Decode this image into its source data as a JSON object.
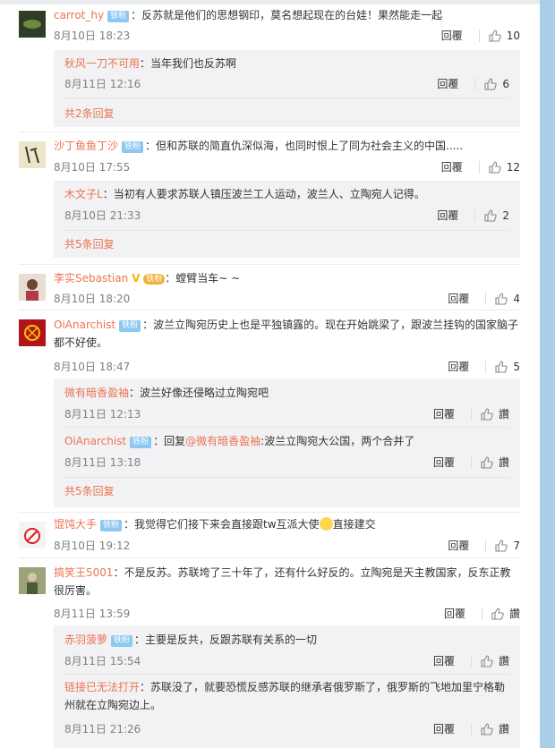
{
  "comments": [
    {
      "user": "carrot_hy",
      "badge": "铁粉",
      "text": "：反苏就是他们的思想钢印，莫名想起现在的台娃！果然能走一起",
      "time": "8月10日 18:23",
      "reply": "回覆",
      "likes": "10",
      "subs": [
        {
          "user": "秋风一刀不可用",
          "text": "：当年我们也反苏啊",
          "time": "8月11日 12:16",
          "reply": "回覆",
          "likes": "6"
        }
      ],
      "more": "共2条回复"
    },
    {
      "user": "沙丁鱼鱼丁沙",
      "badge": "铁粉",
      "text": "：但和苏联的简直仇深似海，也同时恨上了同为社会主义的中国.....",
      "time": "8月10日 17:55",
      "reply": "回覆",
      "likes": "12",
      "subs": [
        {
          "user": "木文子L",
          "text": "：当初有人要求苏联人镇压波兰工人运动，波兰人、立陶宛人记得。",
          "time": "8月10日 21:33",
          "reply": "回覆",
          "likes": "2"
        }
      ],
      "more": "共5条回复"
    },
    {
      "user": "李实Sebastian",
      "medal": "铁粉",
      "text": "：螳臂当车~ ~",
      "time": "8月10日 18:20",
      "reply": "回覆",
      "likes": "4"
    },
    {
      "user": "OiAnarchist",
      "badge": "铁粉",
      "text": "：波兰立陶宛历史上也是平独镇露的。现在开始跳梁了，跟波兰挂钩的国家脑子都不好使。",
      "time": "8月10日 18:47",
      "reply": "回覆",
      "likes": "5",
      "subs": [
        {
          "user": "微有暗香盈袖",
          "text": "：波兰好像还侵略过立陶宛吧",
          "time": "8月11日 12:13",
          "reply": "回覆",
          "likes": "讚"
        },
        {
          "user": "OiAnarchist",
          "badge": "铁粉",
          "text_pre": "：回复",
          "mention": "@微有暗香盈袖",
          "text": ":波兰立陶宛大公国，两个合并了",
          "time": "8月11日 13:18",
          "reply": "回覆",
          "likes": "讚"
        }
      ],
      "more": "共5条回复"
    },
    {
      "user": "馄饨大手",
      "badge": "铁粉",
      "text": "：我觉得它们接下来会直接跟tw互派大使",
      "text_after": "直接建交",
      "time": "8月10日 19:12",
      "reply": "回覆",
      "likes": "7"
    },
    {
      "user": "搞笑王5001",
      "text": "：不是反苏。苏联垮了三十年了，还有什么好反的。立陶宛是天主教国家，反东正教很厉害。",
      "time": "8月11日 13:59",
      "reply": "回覆",
      "likes": "讚",
      "subs": [
        {
          "user": "赤羽菠萝",
          "badge": "铁粉",
          "text": "：主要是反共，反跟苏联有关系的一切",
          "time": "8月11日 15:54",
          "reply": "回覆",
          "likes": "讚"
        },
        {
          "user": "链接已无法打开",
          "text": "：苏联没了，就要恐慌反感苏联的继承者俄罗斯了，俄罗斯的飞地加里宁格勒州就在立陶宛边上。",
          "time": "8月11日 21:26",
          "reply": "回覆",
          "likes": "讚"
        }
      ]
    }
  ]
}
